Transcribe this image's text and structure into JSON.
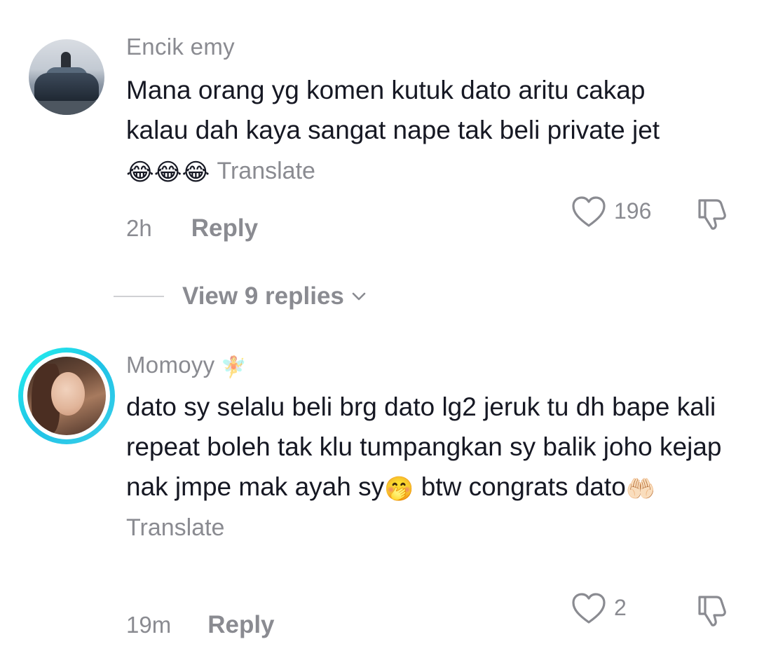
{
  "comments": [
    {
      "username": "Encik emy",
      "text_before_emoji": "Mana orang yg komen kutuk dato aritu cakap kalau dah kaya sangat nape tak beli private jet ",
      "emoji": "😂😂😂",
      "translate_label": "Translate",
      "time": "2h",
      "reply_label": "Reply",
      "like_count": "196",
      "view_replies_label": "View 9 replies"
    },
    {
      "username": "Momoyy",
      "username_emoji": "🧚",
      "text_part1": "dato sy selalu beli brg dato lg2 jeruk tu dh bape kali repeat boleh tak klu tumpangkan sy balik joho kejap nak jmpe mak ayah sy",
      "emoji1": "🤭",
      "text_part2": " btw congrats dato",
      "emoji2": "🤲🏻",
      "translate_label": "Translate",
      "time": "19m",
      "reply_label": "Reply",
      "like_count": "2"
    }
  ],
  "icons": {
    "like": "heart-outline-icon",
    "dislike": "thumbs-down-outline-icon",
    "chevron": "chevron-down-icon"
  },
  "colors": {
    "text_primary": "#161823",
    "text_secondary": "#8a8b91",
    "avatar_ring": "#25f4ee"
  }
}
